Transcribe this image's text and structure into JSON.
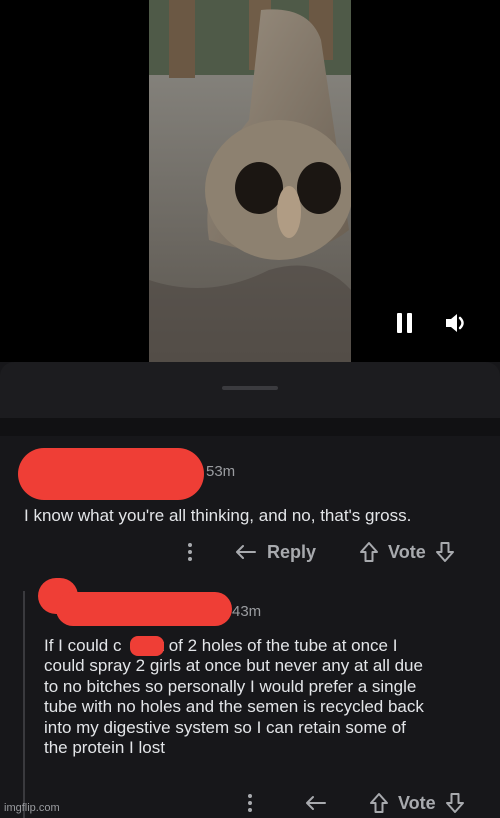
{
  "comments": [
    {
      "timestamp": "53m",
      "body": "I know what you're all thinking, and no, that's gross.",
      "reply_label": "Reply",
      "vote_label": "Vote"
    },
    {
      "timestamp": "43m",
      "lines": [
        "If I could c    out of 2 holes of the tube at once I",
        "could spray 2 girls at once but never any at all due",
        "to no bitches so personally I would prefer a single",
        "tube with no holes and the semen is recycled back",
        "into my digestive system so I can retain some of",
        "the protein I lost"
      ],
      "vote_label": "Vote"
    }
  ],
  "watermark": "imgflip.com",
  "colors": {
    "background": "#17171a",
    "text": "#e3e5e8",
    "muted": "#a8aaae",
    "redaction": "#ef3e36"
  },
  "icons": [
    "pause-icon",
    "volume-icon",
    "more-vertical-icon",
    "reply-icon",
    "upvote-icon",
    "downvote-icon"
  ]
}
